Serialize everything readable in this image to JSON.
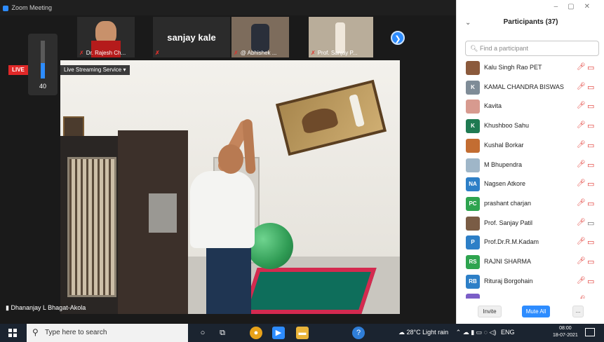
{
  "window": {
    "title": "Zoom Meeting"
  },
  "thumbnails": [
    {
      "label": "Dr. Rajesh Ch..."
    },
    {
      "label": "sanjay kale"
    },
    {
      "label": "@ Abhishek ..."
    },
    {
      "label": "Prof. Sanjay P..."
    }
  ],
  "volume": {
    "value": "40",
    "level": 0.4
  },
  "live_badge": "LIVE",
  "stream_label": "Live Streaming Service",
  "self_view_name": "Dhananjay L Bhagat-Akola",
  "participants_panel": {
    "title": "Participants (37)",
    "search_placeholder": "Find a participant",
    "participants": [
      {
        "name": "Kalu Singh Rao PET",
        "initials": "",
        "color": "#8b5a3c",
        "video": "off"
      },
      {
        "name": "KAMAL CHANDRA BISWAS",
        "initials": "K",
        "color": "#7f8c97",
        "video": "off"
      },
      {
        "name": "Kavita",
        "initials": "",
        "color": "#d79a8f",
        "video": "off"
      },
      {
        "name": "Khushboo Sahu",
        "initials": "K",
        "color": "#1f7a52",
        "video": "off"
      },
      {
        "name": "Kushal Borkar",
        "initials": "",
        "color": "#c36d32",
        "video": "off"
      },
      {
        "name": "M Bhupendra",
        "initials": "",
        "color": "#9fb6c8",
        "video": "off"
      },
      {
        "name": "Nagsen Atkore",
        "initials": "NA",
        "color": "#2d7fc7",
        "video": "off"
      },
      {
        "name": "prashant charjan",
        "initials": "PC",
        "color": "#2ea44f",
        "video": "off"
      },
      {
        "name": "Prof. Sanjay Patil",
        "initials": "",
        "color": "#7a5c45",
        "video": "on"
      },
      {
        "name": "Prof.Dr.R.M.Kadam",
        "initials": "P",
        "color": "#2d7fc7",
        "video": "off"
      },
      {
        "name": "RAJNI SHARMA",
        "initials": "RS",
        "color": "#2ea44f",
        "video": "off"
      },
      {
        "name": "Rituraj Borgohain",
        "initials": "RB",
        "color": "#2d7fc7",
        "video": "off"
      },
      {
        "name": "",
        "initials": "",
        "color": "#7b5ec7",
        "video": "off"
      }
    ],
    "invite_label": "Invite",
    "mute_all_label": "Mute All",
    "more_label": "..."
  },
  "taskbar": {
    "search_placeholder": "Type here to search",
    "weather": "28°C  Light rain",
    "language": "ENG",
    "time": "08:00",
    "date": "18-07-2021"
  },
  "colors": {
    "accent": "#2d8cff",
    "muted_red": "#e0312b",
    "live_red": "#e02828"
  }
}
